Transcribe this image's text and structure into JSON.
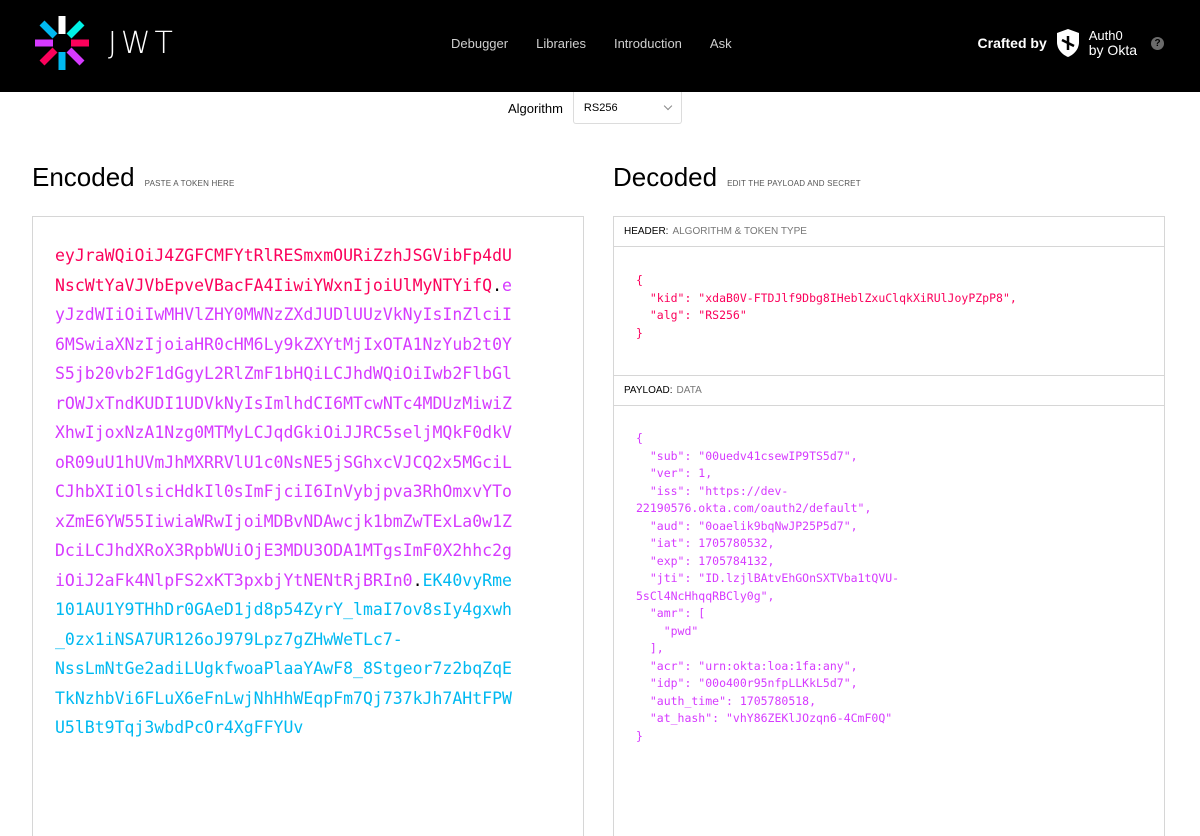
{
  "topbar": {
    "logo_text": "JWT",
    "nav": [
      "Debugger",
      "Libraries",
      "Introduction",
      "Ask"
    ],
    "crafted_label": "Crafted by",
    "okta_line1": "Auth0",
    "okta_line2": "by Okta",
    "help_glyph": "?"
  },
  "algorithm": {
    "label": "Algorithm",
    "value": "RS256"
  },
  "encoded": {
    "title": "Encoded",
    "subtitle": "PASTE A TOKEN HERE",
    "header_part": "eyJraWQiOiJ4ZGFCMFYtRlRESmxmOURiZzhJSGVibFp4dUNscWtYaVJVbEpveVBacFA4IiwiYWxnIjoiUlMyNTYifQ",
    "payload_part": "eyJzdWIiOiIwMHVlZHY0MWNzZXdJUDlUUzVkNyIsInZlciI6MSwiaXNzIjoiaHR0cHM6Ly9kZXYtMjIxOTA1NzYub2t0YS5jb20vb2F1dGgyL2RlZmF1bHQiLCJhdWQiOiIwb2FlbGlrOWJxTndKUDI1UDVkNyIsImlhdCI6MTcwNTc4MDUzMiwiZXhwIjoxNzA1Nzg0MTMyLCJqdGkiOiJJRC5seljMQkF0dkVoR09uU1hUVmJhMXRRVlU1c0NsNE5jSGhxcVJCQ2x5MGciLCJhbXIiOlsicHdkIl0sImFjciI6InVybjpva3RhOmxvYToxZmE6YW55IiwiaWRwIjoiMDBvNDAwcjk1bmZwTExLa0w1ZDciLCJhdXRoX3RpbWUiOjE3MDU3ODA1MTgsImF0X2hhc2giOiJ2aFk4NlpFS2xKT3pxbjYtNENtRjBRIn0",
    "sig_part": "EK40vyRme101AU1Y9THhDr0GAeD1jd8p54ZyrY_lmaI7ov8sIy4gxwh_0zx1iNSA7UR126oJ979Lpz7gZHwWeTLc7-",
    "sig_part2": "NssLmNtGe2adiLUgkfwoaPlaaYAwF8_8Stgeor7z2bqZqETkNzhbVi6FLuX6eFnLwjNhHhWEqpFm7Qj737kJh7AHtFPWU5lBt9Tqj3wbdPcOr4XgFFYUv"
  },
  "decoded": {
    "title": "Decoded",
    "subtitle": "EDIT THE PAYLOAD AND SECRET",
    "header_label": "HEADER:",
    "header_sub": "ALGORITHM & TOKEN TYPE",
    "header_json": "{\n  \"kid\": \"xdaB0V-FTDJlf9Dbg8IHeblZxuClqkXiRUlJoyPZpP8\",\n  \"alg\": \"RS256\"\n}",
    "payload_label": "PAYLOAD:",
    "payload_sub": "DATA",
    "payload_json": "{\n  \"sub\": \"00uedv41csewIP9TS5d7\",\n  \"ver\": 1,\n  \"iss\": \"https://dev-\n22190576.okta.com/oauth2/default\",\n  \"aud\": \"0oaelik9bqNwJP25P5d7\",\n  \"iat\": 1705780532,\n  \"exp\": 1705784132,\n  \"jti\": \"ID.lzjlBAtvEhGOnSXTVba1tQVU-\n5sCl4NcHhqqRBCly0g\",\n  \"amr\": [\n    \"pwd\"\n  ],\n  \"acr\": \"urn:okta:loa:1fa:any\",\n  \"idp\": \"00o400r95nfpLLKkL5d7\",\n  \"auth_time\": 1705780518,\n  \"at_hash\": \"vhY86ZEKlJOzqn6-4CmF0Q\"\n}"
  }
}
